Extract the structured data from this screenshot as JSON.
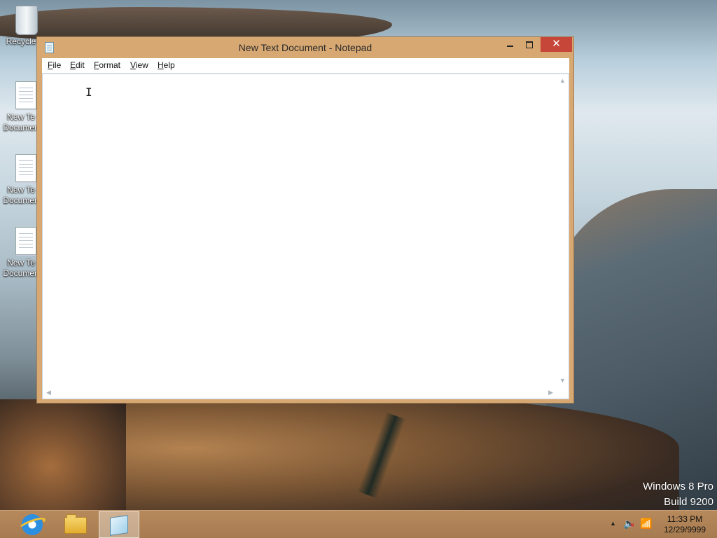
{
  "desktop": {
    "icons": [
      {
        "label": "Recycle"
      },
      {
        "label": "New Te\nDocumen"
      },
      {
        "label": "New Te\nDocumen"
      },
      {
        "label": "New Te\nDocumen"
      }
    ],
    "watermark": {
      "line1": "Windows 8 Pro",
      "line2": "Build 9200"
    }
  },
  "window": {
    "title": "New Text Document - Notepad",
    "menu": [
      "File",
      "Edit",
      "Format",
      "View",
      "Help"
    ],
    "content": "",
    "close_glyph": "✕"
  },
  "taskbar": {
    "items": [
      "internet-explorer",
      "file-explorer",
      "notepad"
    ],
    "active": "notepad",
    "clock": {
      "time": "11:33 PM",
      "date": "12/29/9999"
    }
  },
  "colors": {
    "window_frame": "#d7a872",
    "close_button": "#c7463a",
    "taskbar": "#b78a5c"
  }
}
